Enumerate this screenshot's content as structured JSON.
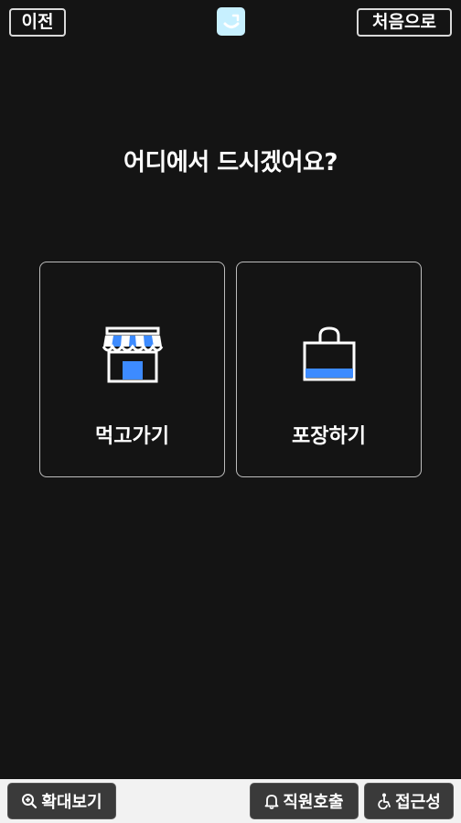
{
  "header": {
    "prev_label": "이전",
    "home_label": "처음으로",
    "logo_icon": "app-logo-icon"
  },
  "main": {
    "title": "어디에서 드시겠어요?",
    "options": [
      {
        "label": "먹고가기",
        "icon": "store-icon"
      },
      {
        "label": "포장하기",
        "icon": "shopping-bag-icon"
      }
    ]
  },
  "footer": {
    "zoom_label": "확대보기",
    "call_label": "직원호출",
    "access_label": "접근성"
  },
  "colors": {
    "background": "#141414",
    "accent": "#3d8bff",
    "card_border": "#bdbdbd",
    "bottom_bar": "#f2f2f2"
  }
}
